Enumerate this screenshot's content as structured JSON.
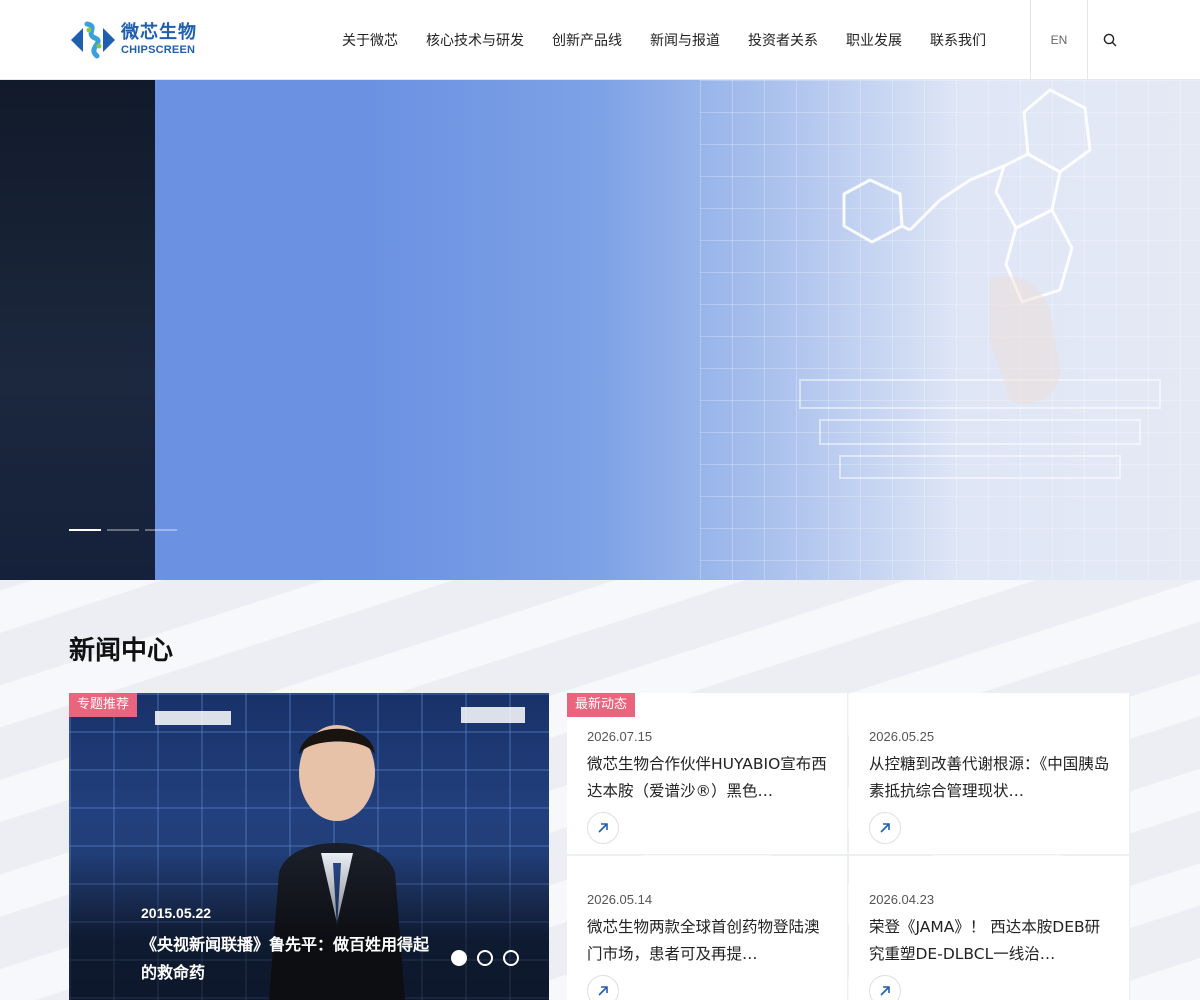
{
  "header": {
    "logo": {
      "cn": "微芯生物",
      "en": "CHIPSCREEN"
    },
    "nav": [
      "关于微芯",
      "核心技术与研发",
      "创新产品线",
      "新闻与报道",
      "投资者关系",
      "职业发展",
      "联系我们"
    ],
    "lang": "EN",
    "search_icon": "search-icon"
  },
  "hero": {
    "slides_total": 3,
    "active_slide": 1
  },
  "news": {
    "title": "新闻中心",
    "feature": {
      "tag": "专题推荐",
      "date": "2015.05.22",
      "headline": "《央视新闻联播》鲁先平：做百姓用得起的救命药",
      "slides_total": 3,
      "active_slide": 1
    },
    "latest_tag": "最新动态",
    "items": [
      {
        "date": "2026.07.15",
        "title": "微芯生物合作伙伴HUYABIO宣布西达本胺（爱谱沙®）黑色…"
      },
      {
        "date": "2026.05.25",
        "title": "从控糖到改善代谢根源：《中国胰岛素抵抗综合管理现状…"
      },
      {
        "date": "2026.05.14",
        "title": "微芯生物两款全球首创药物登陆澳门市场，患者可及再提…"
      },
      {
        "date": "2026.04.23",
        "title": "荣登《JAMA》！ 西达本胺DEB研究重塑DE-DLBCL一线治…"
      }
    ]
  }
}
